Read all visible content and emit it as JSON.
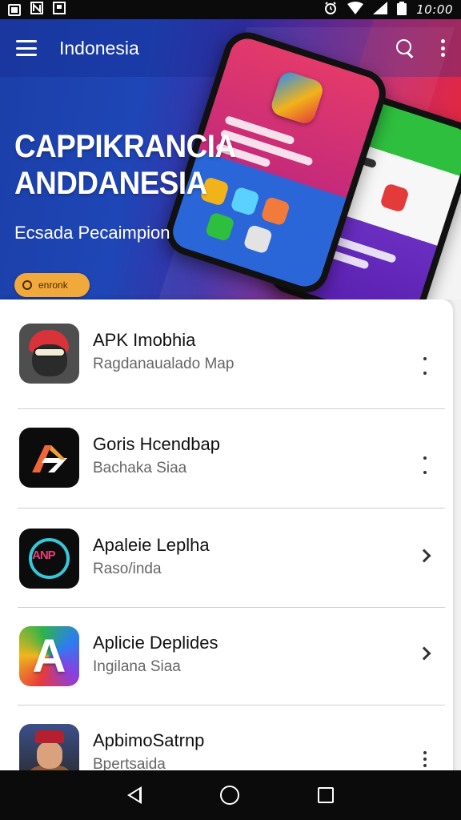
{
  "status_bar": {
    "time": "10:00"
  },
  "app_bar": {
    "title": "Indonesia"
  },
  "hero": {
    "headline_line1": "CAPPIKRANCIA",
    "headline_line2": "ANDDANESIA",
    "subtitle": "Ecsada Pecaimpion",
    "cta_label": "enronk"
  },
  "apps": [
    {
      "title": "APK Imobhia",
      "subtitle": "Ragdanaualado Map",
      "icon": "avatar-red-hat-icon"
    },
    {
      "title": "Goris Hcendbap",
      "subtitle": "Bachaka Siaa",
      "icon": "orange-arrow-logo-icon"
    },
    {
      "title": "Apaleie Leplha",
      "subtitle": "Raso/inda",
      "icon": "apk-ring-logo-icon"
    },
    {
      "title": "Aplicie Deplides",
      "subtitle": "Ingilana Siaa",
      "icon": "rainbow-a-logo-icon"
    },
    {
      "title": "ApbimoSatrnp",
      "subtitle": "Bpertsaida",
      "icon": "man-portrait-icon"
    }
  ],
  "colors": {
    "accent_cta": "#f2a93b",
    "hero_start": "#1c3fa8",
    "hero_end": "#e8222f"
  }
}
